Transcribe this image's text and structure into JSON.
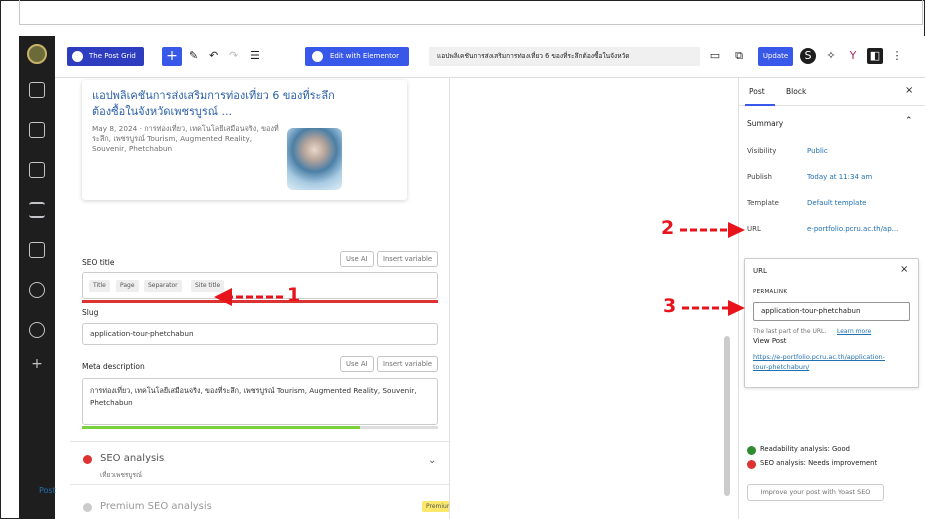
{
  "toolbar": {
    "post_grid_label": "The Post Grid",
    "elementor_label": "Edit with Elementor",
    "doc_title": "แอปพลิเคชันการส่งเสริมการท่องเที่ยว 6 ของที่ระลึกต้องซื้อในจังหวัด",
    "update_label": "Update"
  },
  "card": {
    "title": "แอปพลิเคชันการส่งเสริมการท่องเที่ยว 6 ของที่ระลึกต้องซื้อในจังหวัดเพชรบูรณ์ ...",
    "meta": "May 8, 2024 · การท่องเที่ยว, เทคโนโลยีเสมือนจริง, ของที่ระลึก, เพชรบูรณ์ Tourism, Augmented Reality, Souvenir, Phetchabun"
  },
  "seo": {
    "seo_title_label": "SEO title",
    "use_ai": "Use AI",
    "insert_variable": "Insert variable",
    "pills": [
      "Title",
      "Page",
      "Separator",
      "Site title"
    ],
    "slug_label": "Slug",
    "slug_value": "application-tour-phetchabun",
    "meta_label": "Meta description",
    "meta_value": "การท่องเที่ยว, เทคโนโลยีเสมือนจริง, ของที่ระลึก, เพชรบูรณ์ Tourism, Augmented Reality, Souvenir, Phetchabun",
    "meta_progress": 0.78,
    "analysis_label": "SEO analysis",
    "analysis_keyword": "เที่ยวเพชรบูรณ์",
    "premium_label": "Premium SEO analysis",
    "premium_badge": "Premium"
  },
  "sidebar_right": {
    "tab_post": "Post",
    "tab_block": "Block",
    "summary_label": "Summary",
    "rows": [
      {
        "label": "Visibility",
        "value": "Public"
      },
      {
        "label": "Publish",
        "value": "Today at 11:34 am"
      },
      {
        "label": "Template",
        "value": "Default template"
      },
      {
        "label": "URL",
        "value": "e-portfolio.pcru.ac.th/ap..."
      }
    ],
    "url_popover": {
      "title": "URL",
      "permalink_label": "PERMALINK",
      "permalink_value": "application-tour-phetchabun",
      "help": "The last part of the URL.",
      "learn_more": "Learn more",
      "view_post": "View Post",
      "full_url_1": "https://e-portfolio.pcru.ac.th/application-",
      "full_url_2": "tour-phetchabun/"
    },
    "readability": "Readability analysis: Good",
    "seo_status": "SEO analysis: Needs improvement",
    "improve_button": "Improve your post with Yoast SEO"
  },
  "admin": {
    "post_label": "Post"
  },
  "annotations": {
    "a1": "1",
    "a2": "2",
    "a3": "3"
  },
  "colors": {
    "accent": "#3858e9",
    "annotation": "#e8141b",
    "good": "#7ad03a",
    "bad": "#dc3232"
  }
}
